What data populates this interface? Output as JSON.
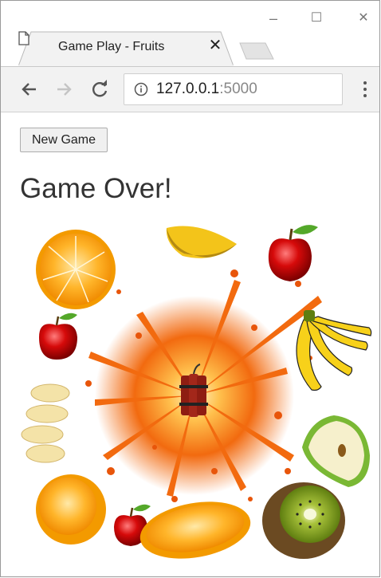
{
  "window": {
    "tab_title": "Game Play - Fruits",
    "tab_close": "✕",
    "controls": {
      "minimize": "–",
      "maximize": "☐",
      "close": "✕"
    }
  },
  "toolbar": {
    "back_icon": "arrow-left-icon",
    "forward_icon": "arrow-right-icon",
    "reload_icon": "reload-icon",
    "url_host": "127.0.0.1",
    "url_port": ":5000"
  },
  "page": {
    "new_game_label": "New Game",
    "heading": "Game Over!"
  },
  "scene": {
    "center": "bomb-explosion",
    "fruits": [
      "orange",
      "mango-slice",
      "apple",
      "apple",
      "banana-bunch",
      "banana-slices",
      "apple-slice",
      "orange-half",
      "apple",
      "orange-slice",
      "kiwi"
    ]
  },
  "colors": {
    "accent_explosion": "#f26a0f",
    "tab_bg": "#f2f2f2"
  }
}
